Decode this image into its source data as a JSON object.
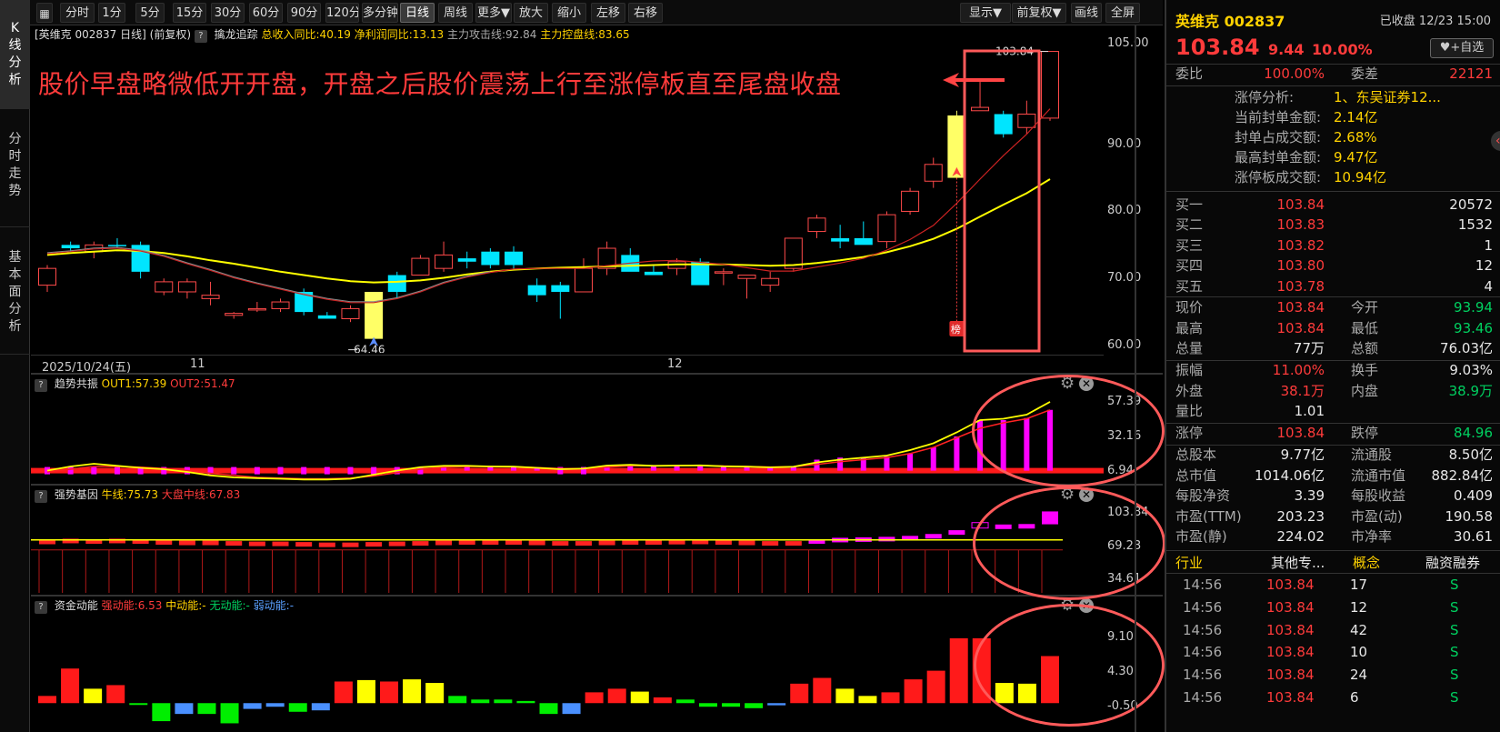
{
  "toolbar": {
    "buttons": [
      "分时",
      "1分",
      "5分",
      "15分",
      "30分",
      "60分",
      "90分",
      "120分",
      "多分钟",
      "日线",
      "周线",
      "更多▼",
      "放大",
      "缩小",
      "左移",
      "右移"
    ],
    "active": "日线",
    "right_buttons": [
      "显示▼",
      "前复权▼",
      "画线",
      "全屏"
    ]
  },
  "side_tabs": [
    "K线分析",
    "分时走势",
    "基本面分析"
  ],
  "main_info": {
    "title": "[英维克 002837 日线]",
    "adjust": "(前复权)",
    "indicator": "擒龙追踪",
    "rev": "总收入同比:40.19",
    "profit": "净利润同比:13.13",
    "attack": "主力攻击线:92.84",
    "control": "主力控盘线:83.65"
  },
  "annotation": "股价早盘略微低开开盘，开盘之后股价震荡上行至涨停板直至尾盘收盘",
  "labels": {
    "high_label": "103.84",
    "low_label": "64.46",
    "bang": "榜",
    "start_date": "2025/10/24(五)",
    "month1": "11",
    "month2": "12"
  },
  "price_axis": [
    "105.00",
    "90.00",
    "80.00",
    "70.00",
    "60.00"
  ],
  "panel1": {
    "name": "趋势共振",
    "out1": "OUT1:57.39",
    "out2": "OUT2:51.47",
    "axis": [
      "57.39",
      "32.16",
      "6.94"
    ]
  },
  "panel2": {
    "name": "强势基因",
    "l1": "牛线:75.73",
    "l2": "大盘中线:67.83",
    "axis": [
      "103.84",
      "69.23",
      "34.61"
    ]
  },
  "panel3": {
    "name": "资金动能",
    "s": "强动能:6.53",
    "m": "中动能:-",
    "w": "无动能:-",
    "r": "弱动能:-",
    "axis": [
      "9.10",
      "4.30",
      "-0.50"
    ]
  },
  "chart_data": {
    "type": "candlestick",
    "candles": [
      [
        69.0,
        72.0,
        68.0,
        71.5
      ],
      [
        75.0,
        75.5,
        74.0,
        74.5
      ],
      [
        74.0,
        75.5,
        73.0,
        75.0
      ],
      [
        75.0,
        76.0,
        74.5,
        74.8
      ],
      [
        75.0,
        75.5,
        70.0,
        71.0
      ],
      [
        68.0,
        70.0,
        67.5,
        69.5
      ],
      [
        68.0,
        70.0,
        67.0,
        69.5
      ],
      [
        67.0,
        69.5,
        66.0,
        67.5
      ],
      [
        64.5,
        65.0,
        64.0,
        64.8
      ],
      [
        65.5,
        66.5,
        65.0,
        65.5
      ],
      [
        65.5,
        67.0,
        65.0,
        66.5
      ],
      [
        68.0,
        68.5,
        64.5,
        65.0
      ],
      [
        64.5,
        65.0,
        64.0,
        64.0
      ],
      [
        64.0,
        66.0,
        63.5,
        65.5
      ],
      [
        68.0,
        68.0,
        61.0,
        61.0
      ],
      [
        70.5,
        71.0,
        67.0,
        68.0
      ],
      [
        70.5,
        73.5,
        70.5,
        73.0
      ],
      [
        71.5,
        75.5,
        71.0,
        73.5
      ],
      [
        73.0,
        74.0,
        71.5,
        72.5
      ],
      [
        74.0,
        74.5,
        71.5,
        72.0
      ],
      [
        74.0,
        74.8,
        71.2,
        72.0
      ],
      [
        69.0,
        70.0,
        66.5,
        67.5
      ],
      [
        69.0,
        69.5,
        64.0,
        68.0
      ],
      [
        68.0,
        73.0,
        68.0,
        71.5
      ],
      [
        71.5,
        75.5,
        70.5,
        74.5
      ],
      [
        73.5,
        74.5,
        71.5,
        71.0
      ],
      [
        71.0,
        72.0,
        70.5,
        70.5
      ],
      [
        71.5,
        73.0,
        70.5,
        72.5
      ],
      [
        72.5,
        73.0,
        69.5,
        69.0
      ],
      [
        71.0,
        71.5,
        69.0,
        71.0
      ],
      [
        70.0,
        70.5,
        67.0,
        70.5
      ],
      [
        69.0,
        71.0,
        68.0,
        70.0
      ],
      [
        71.5,
        76.0,
        71.0,
        76.0
      ],
      [
        77.0,
        79.5,
        76.0,
        79.0
      ],
      [
        76.0,
        78.0,
        74.5,
        75.5
      ],
      [
        76.0,
        78.5,
        75.5,
        75.0
      ],
      [
        75.5,
        80.0,
        74.5,
        79.5
      ],
      [
        80.0,
        83.5,
        79.5,
        83.0
      ],
      [
        84.5,
        88.0,
        83.5,
        87.0
      ],
      [
        85.0,
        95.0,
        85.0,
        94.3
      ],
      [
        95.0,
        99.5,
        95.0,
        95.5
      ],
      [
        94.5,
        95.0,
        91.0,
        91.5
      ],
      [
        92.5,
        96.5,
        91.5,
        94.5
      ],
      [
        93.9,
        103.84,
        93.5,
        103.84
      ]
    ],
    "limit_up_days": [
      14,
      39
    ],
    "ma_fast": [
      73.7,
      74.0,
      74.4,
      74.5,
      74.1,
      73.3,
      72.2,
      71.2,
      70.1,
      69.2,
      68.4,
      67.6,
      66.9,
      66.4,
      66.4,
      67.0,
      68.0,
      69.3,
      70.2,
      70.9,
      71.4,
      71.5,
      71.5,
      71.5,
      71.9,
      72.3,
      72.6,
      72.7,
      72.4,
      72.1,
      71.6,
      71.1,
      71.1,
      71.7,
      72.3,
      73.0,
      74.2,
      75.8,
      77.9,
      81.2,
      84.8,
      88.3,
      91.5,
      95.3
    ],
    "ma_slow": [
      73.5,
      73.8,
      74.0,
      74.2,
      74.1,
      73.8,
      73.3,
      72.7,
      72.2,
      71.6,
      71.0,
      70.5,
      70.0,
      69.6,
      69.4,
      69.5,
      69.7,
      70.1,
      70.6,
      71.0,
      71.3,
      71.5,
      71.6,
      71.7,
      71.8,
      71.9,
      72.0,
      72.1,
      72.1,
      72.1,
      72.0,
      71.9,
      72.0,
      72.3,
      72.7,
      73.2,
      73.9,
      74.8,
      75.9,
      77.4,
      79.2,
      81.0,
      82.7,
      84.8
    ],
    "price_range": [
      60,
      105
    ],
    "panel1_bars": [
      6.94,
      6.94,
      6.94,
      6.94,
      6.94,
      6.94,
      6.94,
      6.94,
      6.94,
      6.94,
      6.94,
      6.94,
      6.94,
      6.94,
      6.94,
      6.94,
      6.94,
      10.5,
      10.5,
      10.5,
      9.9,
      9.5,
      6.94,
      6.94,
      10.7,
      11.2,
      10.5,
      10.7,
      10.8,
      10.1,
      9.9,
      9.3,
      9.8,
      15.0,
      16.5,
      16.5,
      17.4,
      19.3,
      24.0,
      32.0,
      44.0,
      44.0,
      45.5,
      51.5
    ],
    "panel1_out1": [
      7.0,
      10.0,
      12.0,
      10.5,
      9.0,
      8.0,
      6.0,
      3.5,
      2.0,
      1.5,
      1.0,
      0.5,
      0.5,
      1.0,
      4.0,
      7.0,
      9.5,
      10.5,
      10.5,
      10.0,
      9.9,
      9.0,
      8.0,
      8.5,
      10.7,
      11.2,
      10.5,
      10.7,
      10.8,
      10.1,
      9.9,
      9.3,
      9.8,
      13.0,
      15.0,
      16.5,
      18.0,
      22.0,
      27.0,
      35.0,
      44.0,
      45.0,
      48.0,
      57.39
    ],
    "panel1_out2": [
      6.0,
      8.0,
      10.0,
      10.0,
      9.5,
      8.5,
      7.0,
      5.0,
      3.5,
      2.0,
      1.5,
      1.0,
      1.0,
      1.5,
      3.0,
      5.5,
      8.0,
      9.5,
      10.0,
      10.0,
      9.9,
      9.2,
      8.5,
      8.5,
      9.5,
      10.5,
      10.5,
      10.6,
      10.7,
      10.3,
      10.0,
      9.6,
      9.8,
      11.5,
      13.5,
      15.0,
      16.5,
      19.5,
      24.0,
      31.0,
      38.0,
      42.0,
      45.0,
      51.47
    ],
    "panel1_range": [
      0,
      60
    ],
    "panel2_bull": [
      75.73
    ],
    "panel2_range": [
      20,
      110
    ],
    "panel3_values": [
      1.0,
      4.8,
      2.0,
      2.5,
      -0.2,
      -2.5,
      -1.5,
      -1.5,
      -2.8,
      -0.8,
      -0.5,
      -1.2,
      -1.0,
      3.0,
      3.2,
      3.0,
      3.3,
      2.8,
      1.0,
      0.5,
      0.5,
      0.3,
      -1.5,
      -1.5,
      1.5,
      2.0,
      1.6,
      0.8,
      0.5,
      -0.5,
      -0.5,
      -0.7,
      -0.3,
      2.7,
      3.5,
      2.0,
      1.0,
      1.5,
      3.3,
      4.5,
      9.0,
      9.0,
      2.8,
      2.7,
      6.53
    ],
    "panel3_colors": [
      "red",
      "red",
      "yellow",
      "red",
      "green",
      "green",
      "blue",
      "green",
      "green",
      "blue",
      "blue",
      "green",
      "blue",
      "red",
      "yellow",
      "red",
      "yellow",
      "yellow",
      "green",
      "green",
      "green",
      "green",
      "green",
      "blue",
      "red",
      "red",
      "yellow",
      "red",
      "green",
      "green",
      "green",
      "green",
      "blue",
      "red",
      "red",
      "yellow",
      "yellow",
      "red",
      "red",
      "red",
      "red",
      "red",
      "yellow",
      "yellow",
      "red"
    ],
    "panel3_range": [
      -3.5,
      10
    ]
  },
  "stock": {
    "name": "英维克 002837",
    "status": "已收盘 12/23 15:00",
    "price": "103.84",
    "change": "9.44",
    "pct": "10.00%",
    "fav": "♥+自选",
    "weibi_label": "委比",
    "weibi": "100.00%",
    "weicha_label": "委差",
    "weicha": "22121",
    "zt_rows": [
      {
        "label": "涨停分析:",
        "value": "1、东吴证券12..."
      },
      {
        "label": "当前封单金额:",
        "value": "2.14亿"
      },
      {
        "label": "封单占成交额:",
        "value": "2.68%"
      },
      {
        "label": "最高封单金额:",
        "value": "9.47亿"
      },
      {
        "label": "涨停板成交额:",
        "value": "10.94亿"
      }
    ],
    "bids": [
      {
        "label": "买一",
        "price": "103.84",
        "vol": "20572"
      },
      {
        "label": "买二",
        "price": "103.83",
        "vol": "1532"
      },
      {
        "label": "买三",
        "price": "103.82",
        "vol": "1"
      },
      {
        "label": "买四",
        "price": "103.80",
        "vol": "12"
      },
      {
        "label": "买五",
        "price": "103.78",
        "vol": "4"
      }
    ],
    "stats1": [
      [
        "现价",
        "103.84",
        "今开",
        "93.94"
      ],
      [
        "最高",
        "103.84",
        "最低",
        "93.46"
      ],
      [
        "总量",
        "77万",
        "总额",
        "76.03亿"
      ]
    ],
    "stats2": [
      [
        "振幅",
        "11.00%",
        "换手",
        "9.03%"
      ],
      [
        "外盘",
        "38.1万",
        "内盘",
        "38.9万"
      ],
      [
        "量比",
        "1.01",
        "",
        ""
      ]
    ],
    "stats3": [
      [
        "涨停",
        "103.84",
        "跌停",
        "84.96"
      ]
    ],
    "stats4": [
      [
        "总股本",
        "9.77亿",
        "流通股",
        "8.50亿"
      ],
      [
        "总市值",
        "1014.06亿",
        "流通市值",
        "882.84亿"
      ],
      [
        "每股净资",
        "3.39",
        "每股收益",
        "0.409"
      ],
      [
        "市盈(TTM)",
        "203.23",
        "市盈(动)",
        "190.58"
      ],
      [
        "市盈(静)",
        "224.02",
        "市净率",
        "30.61"
      ]
    ],
    "tabs": [
      "行业",
      "其他专...",
      "概念",
      "融资融券"
    ],
    "ticks": [
      [
        "14:56",
        "103.84",
        "17",
        "S"
      ],
      [
        "14:56",
        "103.84",
        "12",
        "S"
      ],
      [
        "14:56",
        "103.84",
        "42",
        "S"
      ],
      [
        "14:56",
        "103.84",
        "10",
        "S"
      ],
      [
        "14:56",
        "103.84",
        "24",
        "S"
      ],
      [
        "14:56",
        "103.84",
        "6",
        "S"
      ]
    ],
    "colors": {
      "up": "#ff3b3b",
      "down": "#00e5ff",
      "limit": "#ffff66",
      "accent": "#ffd200"
    }
  }
}
